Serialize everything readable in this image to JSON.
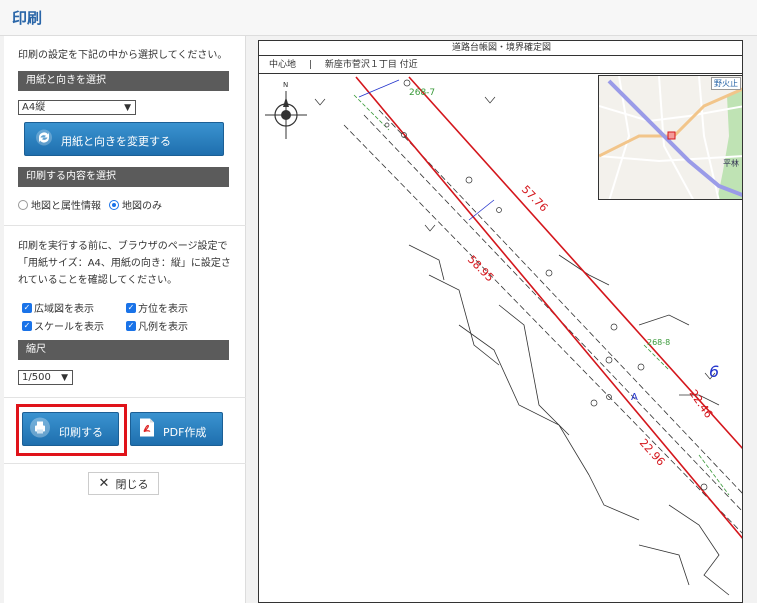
{
  "header": {
    "title": "印刷"
  },
  "panel": {
    "intro": "印刷の設定を下記の中から選択してください。",
    "paper_section": "用紙と向きを選択",
    "paper_select": "A4縦",
    "change_button": "用紙と向きを変更する",
    "content_section": "印刷する内容を選択",
    "radio_attr": "地図と属性情報",
    "radio_map": "地図のみ",
    "note": "印刷を実行する前に、ブラウザのページ設定で「用紙サイズ：A4、用紙の向き：縦」に設定されていることを確認してください。",
    "checkboxes": [
      "広域図を表示",
      "方位を表示",
      "スケールを表示",
      "凡例を表示"
    ],
    "scale_section": "縮尺",
    "scale_select": "1/500",
    "print_button": "印刷する",
    "pdf_button": "PDF作成",
    "close_button": "閉じる"
  },
  "map": {
    "title": "道路台帳図・境界確定図",
    "location_label": "中心地",
    "location_sep": "|",
    "location_value": "新座市菅沢１丁目 付近",
    "north_label": "N",
    "labels": [
      "268-7",
      "57.76",
      "58.95",
      "268-8",
      "A",
      "22.46",
      "22.96",
      "6",
      "野火止",
      "平林"
    ]
  },
  "colors": {
    "accent": "#2a66a8",
    "button": "#2a7fc0",
    "highlight": "#e0131a"
  }
}
